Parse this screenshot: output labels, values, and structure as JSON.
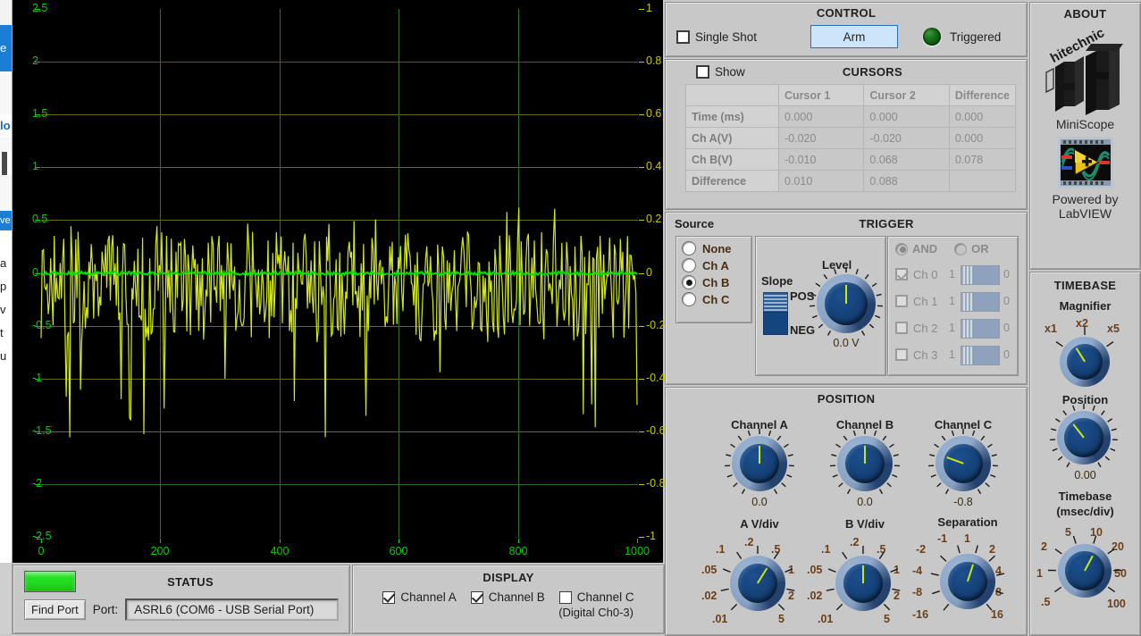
{
  "background_window": {
    "fragments": [
      "e",
      "lo",
      "ve",
      "a",
      "p",
      "v",
      "t",
      "u"
    ]
  },
  "scope": {
    "left_axis": {
      "ticks": [
        "2.5",
        "2",
        "1.5",
        "1",
        "0.5",
        "0",
        "-0.5",
        "-1",
        "-1.5",
        "-2",
        "-2.5"
      ],
      "color": "#00d000"
    },
    "right_axis": {
      "ticks": [
        "1",
        "0.8",
        "0.6",
        "0.4",
        "0.2",
        "0",
        "-0.2",
        "-0.4",
        "-0.6",
        "-0.8",
        "-1"
      ],
      "color": "#c8c800"
    },
    "x_axis": {
      "ticks": [
        "0",
        "200",
        "400",
        "600",
        "800",
        "1000"
      ]
    }
  },
  "chart_data": {
    "type": "line",
    "title": "",
    "xlabel": "",
    "ylabel": "",
    "xlim": [
      0,
      1000
    ],
    "ylim_left": [
      -2.5,
      2.5
    ],
    "ylim_right": [
      -1,
      1
    ],
    "grid": true,
    "legend": "none",
    "series": [
      {
        "name": "Channel A",
        "color": "#00e000",
        "axis": "left",
        "description": "flat near 0 V with tiny ripple"
      },
      {
        "name": "Channel B",
        "color": "#d4e815",
        "axis": "right",
        "description": "random noise, approx -0.5 to +0.25 V with occasional spikes to -0.6"
      }
    ]
  },
  "control": {
    "title": "CONTROL",
    "single_shot_label": "Single Shot",
    "single_shot_checked": false,
    "arm_label": "Arm",
    "triggered_label": "Triggered",
    "led_color": "#157015"
  },
  "cursors": {
    "title": "CURSORS",
    "show_label": "Show",
    "show_checked": false,
    "columns": [
      "",
      "Cursor 1",
      "Cursor 2",
      "Difference"
    ],
    "rows": [
      {
        "label": "Time (ms)",
        "cells": [
          "0.000",
          "0.000",
          "0.000"
        ]
      },
      {
        "label": "Ch A(V)",
        "cells": [
          "-0.020",
          "-0.020",
          "0.000"
        ]
      },
      {
        "label": "Ch B(V)",
        "cells": [
          "-0.010",
          "0.068",
          "0.078"
        ]
      },
      {
        "label": "Difference",
        "cells": [
          "0.010",
          "0.088",
          ""
        ]
      }
    ]
  },
  "trigger": {
    "title": "TRIGGER",
    "source_label": "Source",
    "source_options": [
      "None",
      "Ch A",
      "Ch B",
      "Ch C"
    ],
    "source_selected": "Ch B",
    "slope_label": "Slope",
    "slope_pos": "POS",
    "slope_neg": "NEG",
    "slope_selected": "POS",
    "level_label": "Level",
    "level_value": "0.0 V",
    "logic_and": "AND",
    "logic_or": "OR",
    "logic_selected": "AND",
    "digital": [
      {
        "label": "Ch 0",
        "checked": true,
        "one": "1",
        "zero": "0"
      },
      {
        "label": "Ch 1",
        "checked": false,
        "one": "1",
        "zero": "0"
      },
      {
        "label": "Ch 2",
        "checked": false,
        "one": "1",
        "zero": "0"
      },
      {
        "label": "Ch 3",
        "checked": false,
        "one": "1",
        "zero": "0"
      }
    ]
  },
  "position": {
    "title": "POSITION",
    "knobs": [
      {
        "label": "Channel A",
        "value": "0.0"
      },
      {
        "label": "Channel B",
        "value": "0.0"
      },
      {
        "label": "Channel C",
        "value": "-0.8"
      }
    ],
    "scales": [
      {
        "label": "A V/div",
        "ticks": [
          ".1",
          ".2",
          ".5",
          ".05",
          "1",
          ".02",
          "2",
          ".01",
          "5"
        ]
      },
      {
        "label": "B V/div",
        "ticks": [
          ".1",
          ".2",
          ".5",
          ".05",
          "1",
          ".02",
          "2",
          ".01",
          "5"
        ]
      },
      {
        "label": "Separation",
        "ticks": [
          "-1",
          "1",
          "-2",
          "2",
          "-4",
          "4",
          "-8",
          "8",
          "-16",
          "16"
        ]
      }
    ]
  },
  "status": {
    "title": "STATUS",
    "find_port_label": "Find Port",
    "port_label": "Port:",
    "port_value": "ASRL6  (COM6 - USB Serial Port)",
    "led_color": "#22e022"
  },
  "display": {
    "title": "DISPLAY",
    "channels": [
      {
        "label": "Channel A",
        "checked": true
      },
      {
        "label": "Channel B",
        "checked": true
      },
      {
        "label": "Channel C",
        "checked": false
      }
    ],
    "note": "(Digital Ch0-3)"
  },
  "about": {
    "title": "ABOUT",
    "logo_text": "hitechnic",
    "logo_mark": "HT",
    "product": "MiniScope",
    "powered_line1": "Powered by",
    "powered_line2": "LabVIEW"
  },
  "timebase": {
    "title": "TIMEBASE",
    "magnifier_label": "Magnifier",
    "magnifier_ticks": [
      "x1",
      "x2",
      "x5"
    ],
    "position_label": "Position",
    "position_value": "0.00",
    "timebase_label": "Timebase",
    "timebase_units": "(msec/div)",
    "timebase_ticks": [
      "5",
      "10",
      "2",
      "20",
      "1",
      "50",
      ".5",
      "100"
    ]
  }
}
